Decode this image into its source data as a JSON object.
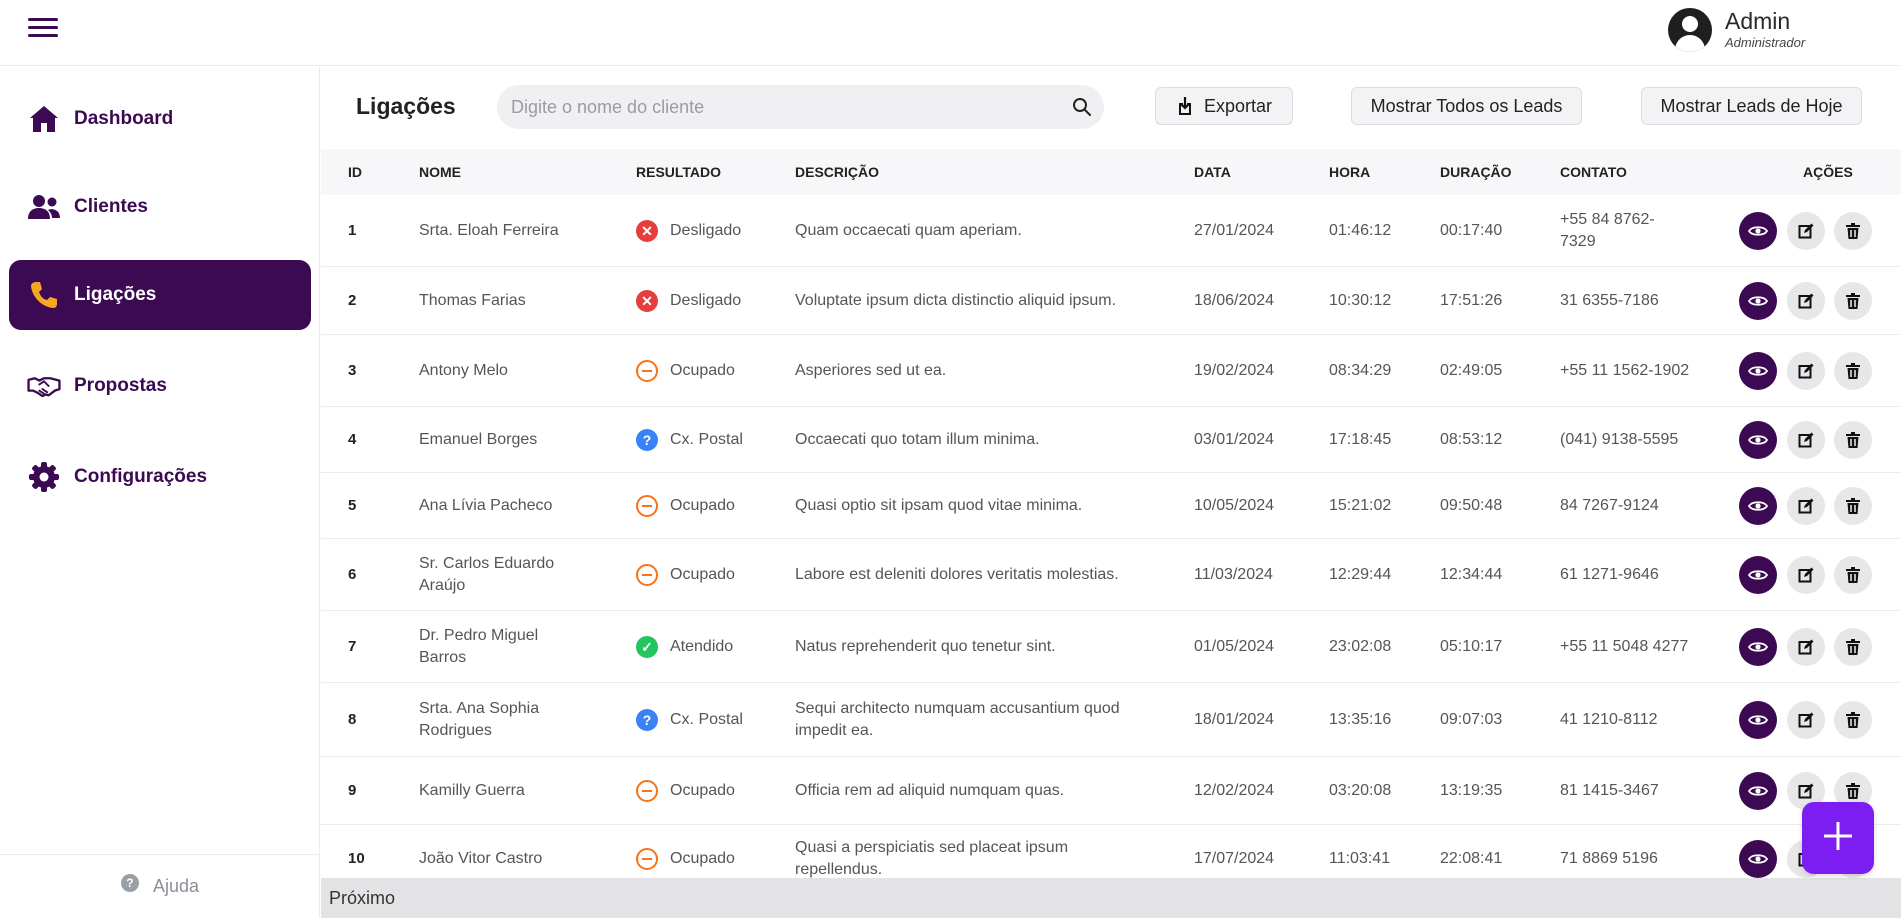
{
  "header": {
    "user_name": "Admin",
    "user_role": "Administrador"
  },
  "sidebar": {
    "items": [
      {
        "label": "Dashboard",
        "icon": "home-icon",
        "active": false
      },
      {
        "label": "Clientes",
        "icon": "users-icon",
        "active": false
      },
      {
        "label": "Ligações",
        "icon": "phone-icon",
        "active": true
      },
      {
        "label": "Propostas",
        "icon": "handshake-icon",
        "active": false
      },
      {
        "label": "Configurações",
        "icon": "gear-icon",
        "active": false
      }
    ],
    "help_label": "Ajuda"
  },
  "main": {
    "title": "Ligações",
    "search_placeholder": "Digite o nome do cliente",
    "export_label": "Exportar",
    "show_all_label": "Mostrar Todos os Leads",
    "show_today_label": "Mostrar Leads de Hoje",
    "columns": [
      "ID",
      "NOME",
      "RESULTADO",
      "DESCRIÇÃO",
      "DATA",
      "HORA",
      "DURAÇÃO",
      "CONTATO",
      "AÇÕES"
    ],
    "rows": [
      {
        "id": "1",
        "name": "Srta. Eloah Ferreira",
        "result": "Desligado",
        "result_type": "red",
        "description": "Quam occaecati quam aperiam.",
        "date": "27/01/2024",
        "time": "01:46:12",
        "duration": "00:17:40",
        "contact": "+55 84 8762-7329"
      },
      {
        "id": "2",
        "name": "Thomas Farias",
        "result": "Desligado",
        "result_type": "red",
        "description": "Voluptate ipsum dicta distinctio aliquid ipsum.",
        "date": "18/06/2024",
        "time": "10:30:12",
        "duration": "17:51:26",
        "contact": "31 6355-7186"
      },
      {
        "id": "3",
        "name": "Antony Melo",
        "result": "Ocupado",
        "result_type": "orange",
        "description": "Asperiores sed ut ea.",
        "date": "19/02/2024",
        "time": "08:34:29",
        "duration": "02:49:05",
        "contact": "+55 11 1562-1902"
      },
      {
        "id": "4",
        "name": "Emanuel Borges",
        "result": "Cx. Postal",
        "result_type": "blue",
        "description": "Occaecati quo totam illum minima.",
        "date": "03/01/2024",
        "time": "17:18:45",
        "duration": "08:53:12",
        "contact": "(041) 9138-5595"
      },
      {
        "id": "5",
        "name": "Ana Lívia Pacheco",
        "result": "Ocupado",
        "result_type": "orange",
        "description": "Quasi optio sit ipsam quod vitae minima.",
        "date": "10/05/2024",
        "time": "15:21:02",
        "duration": "09:50:48",
        "contact": "84 7267-9124"
      },
      {
        "id": "6",
        "name": "Sr. Carlos Eduardo Araújo",
        "result": "Ocupado",
        "result_type": "orange",
        "description": "Labore est deleniti dolores veritatis molestias.",
        "date": "11/03/2024",
        "time": "12:29:44",
        "duration": "12:34:44",
        "contact": "61 1271-9646"
      },
      {
        "id": "7",
        "name": "Dr. Pedro Miguel Barros",
        "result": "Atendido",
        "result_type": "green",
        "description": "Natus reprehenderit quo tenetur sint.",
        "date": "01/05/2024",
        "time": "23:02:08",
        "duration": "05:10:17",
        "contact": "+55 11 5048 4277"
      },
      {
        "id": "8",
        "name": "Srta. Ana Sophia Rodrigues",
        "result": "Cx. Postal",
        "result_type": "blue",
        "description": "Sequi architecto numquam accusantium quod impedit ea.",
        "date": "18/01/2024",
        "time": "13:35:16",
        "duration": "09:07:03",
        "contact": "41 1210-8112"
      },
      {
        "id": "9",
        "name": "Kamilly Guerra",
        "result": "Ocupado",
        "result_type": "orange",
        "description": "Officia rem ad aliquid numquam quas.",
        "date": "12/02/2024",
        "time": "03:20:08",
        "duration": "13:19:35",
        "contact": "81 1415-3467"
      },
      {
        "id": "10",
        "name": "João Vitor Castro",
        "result": "Ocupado",
        "result_type": "orange",
        "description": "Quasi a perspiciatis sed placeat ipsum repellendus.",
        "date": "17/07/2024",
        "time": "11:03:41",
        "duration": "22:08:41",
        "contact": "71 8869 5196"
      }
    ],
    "pager_label": "Próximo"
  },
  "colors": {
    "brand": "#3b0a52",
    "fab": "#7c1df2",
    "active_icon": "#f5a623"
  }
}
